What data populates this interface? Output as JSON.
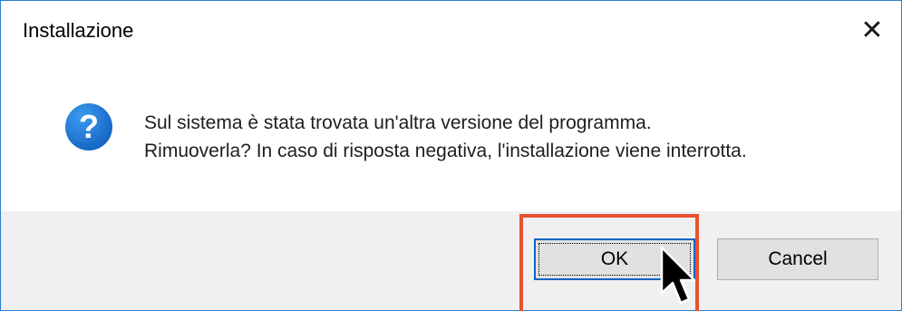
{
  "window": {
    "title": "Installazione",
    "close_icon": "close-icon"
  },
  "message": {
    "icon": "question-icon",
    "icon_glyph": "?",
    "line1": "Sul sistema è stata trovata un'altra versione del programma.",
    "line2": "Rimuoverla? In caso di risposta negativa, l'installazione viene interrotta."
  },
  "buttons": {
    "ok_label": "OK",
    "cancel_label": "Cancel"
  },
  "colors": {
    "window_border": "#2b7fd3",
    "icon_blue": "#1869c6",
    "highlight": "#e8522f",
    "footer_bg": "#f0f0f0"
  }
}
